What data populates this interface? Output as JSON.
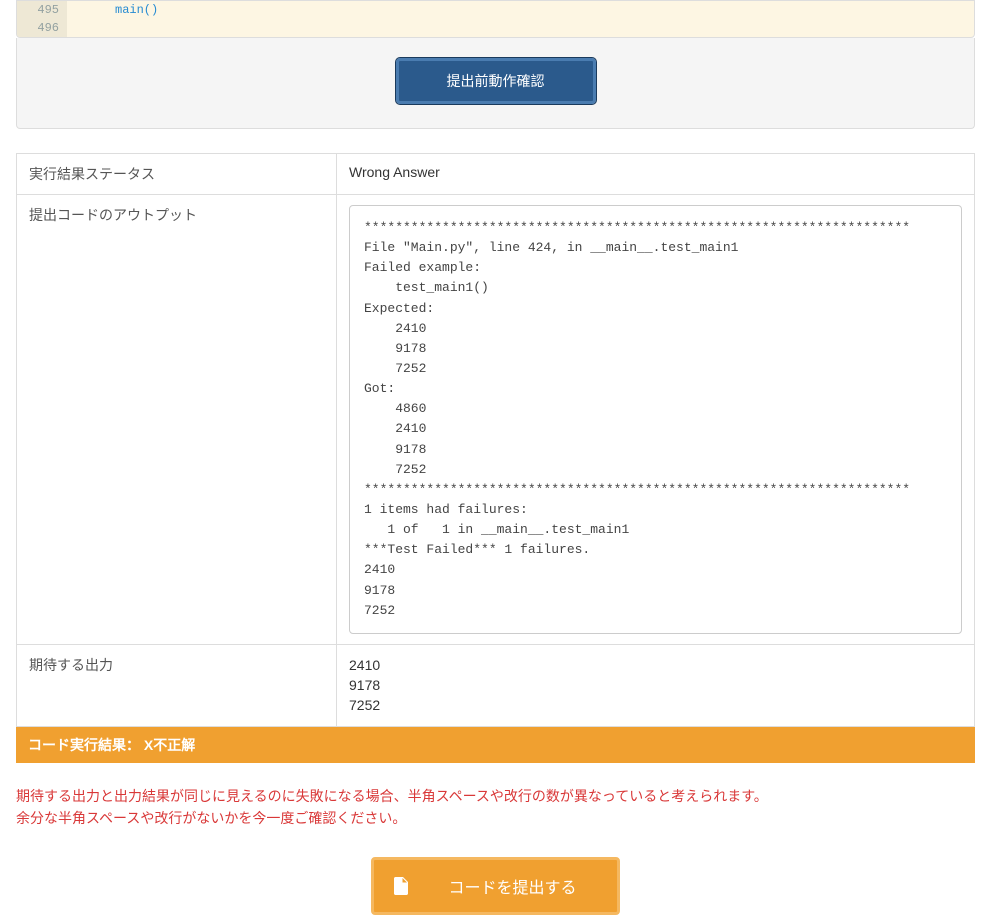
{
  "code": {
    "lines": [
      "495",
      "496"
    ],
    "content": "main()"
  },
  "buttons": {
    "confirm": "提出前動作確認",
    "submit": "コードを提出する"
  },
  "table": {
    "statusLabel": "実行結果ステータス",
    "statusValue": "Wrong Answer",
    "outputLabel": "提出コードのアウトプット",
    "outputValue": "**********************************************************************\nFile \"Main.py\", line 424, in __main__.test_main1\nFailed example:\n    test_main1()\nExpected:\n    2410\n    9178\n    7252\nGot:\n    4860\n    2410\n    9178\n    7252\n**********************************************************************\n1 items had failures:\n   1 of   1 in __main__.test_main1\n***Test Failed*** 1 failures.\n2410\n9178\n7252",
    "expectedLabel": "期待する出力",
    "expectedValue": "2410\n9178\n7252"
  },
  "banner": {
    "prefix": "コード実行結果：  X",
    "result": "不正解"
  },
  "warning": {
    "line1": "期待する出力と出力結果が同じに見えるのに失敗になる場合、半角スペースや改行の数が異なっていると考えられます。",
    "line2": "余分な半角スペースや改行がないかを今一度ご確認ください。"
  }
}
